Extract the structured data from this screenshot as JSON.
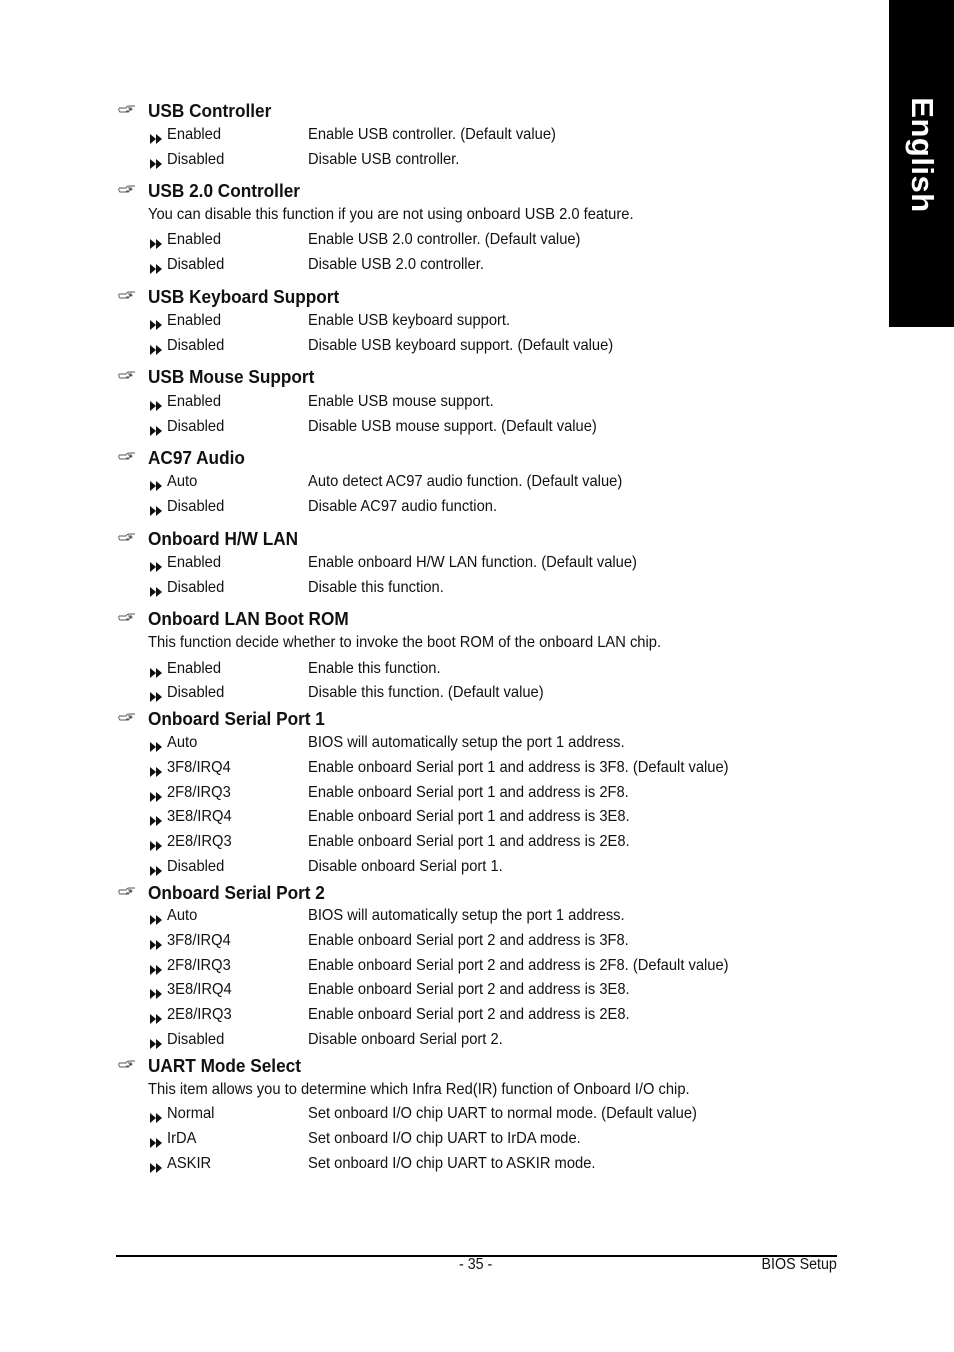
{
  "side_tab": {
    "label": "English"
  },
  "sections": [
    {
      "title": "USB Controller",
      "description": null,
      "options": [
        {
          "value": "Enabled",
          "desc": "Enable USB controller. (Default value)"
        },
        {
          "value": "Disabled",
          "desc": "Disable USB controller."
        }
      ]
    },
    {
      "title": "USB 2.0 Controller",
      "description": "You can disable this function if you are not using onboard USB 2.0 feature.",
      "options": [
        {
          "value": "Enabled",
          "desc": "Enable USB 2.0 controller. (Default value)"
        },
        {
          "value": "Disabled",
          "desc": "Disable USB 2.0 controller."
        }
      ]
    },
    {
      "title": "USB Keyboard Support",
      "description": null,
      "options": [
        {
          "value": "Enabled",
          "desc": "Enable USB keyboard support."
        },
        {
          "value": "Disabled",
          "desc": "Disable USB keyboard support. (Default value)"
        }
      ]
    },
    {
      "title": "USB Mouse Support",
      "description": null,
      "options": [
        {
          "value": "Enabled",
          "desc": "Enable USB mouse support."
        },
        {
          "value": "Disabled",
          "desc": "Disable USB mouse support. (Default value)"
        }
      ]
    },
    {
      "title": "AC97 Audio",
      "description": null,
      "options": [
        {
          "value": "Auto",
          "desc": "Auto detect AC97 audio function. (Default value)"
        },
        {
          "value": "Disabled",
          "desc": "Disable AC97 audio function."
        }
      ]
    },
    {
      "title": "Onboard H/W LAN",
      "description": null,
      "options": [
        {
          "value": "Enabled",
          "desc": "Enable onboard H/W LAN function. (Default value)"
        },
        {
          "value": "Disabled",
          "desc": "Disable this function."
        }
      ]
    },
    {
      "title": "Onboard LAN Boot ROM",
      "description": "This function decide whether to invoke the boot ROM of the onboard LAN chip.",
      "options": [
        {
          "value": "Enabled",
          "desc": "Enable this function."
        },
        {
          "value": "Disabled",
          "desc": "Disable this function. (Default value)"
        }
      ]
    },
    {
      "title": "Onboard Serial Port 1",
      "description": null,
      "options": [
        {
          "value": "Auto",
          "desc": "BIOS will automatically setup the port 1 address."
        },
        {
          "value": "3F8/IRQ4",
          "desc": "Enable onboard Serial port 1 and address is 3F8. (Default value)"
        },
        {
          "value": "2F8/IRQ3",
          "desc": "Enable onboard Serial port 1 and address is 2F8."
        },
        {
          "value": "3E8/IRQ4",
          "desc": "Enable onboard Serial port 1 and address is 3E8."
        },
        {
          "value": "2E8/IRQ3",
          "desc": "Enable onboard Serial port 1 and address is 2E8."
        },
        {
          "value": "Disabled",
          "desc": "Disable onboard Serial port 1."
        }
      ]
    },
    {
      "title": "Onboard Serial Port 2",
      "description": null,
      "options": [
        {
          "value": "Auto",
          "desc": "BIOS will automatically setup the port 1 address."
        },
        {
          "value": "3F8/IRQ4",
          "desc": "Enable onboard Serial port 2 and address is 3F8."
        },
        {
          "value": "2F8/IRQ3",
          "desc": "Enable onboard Serial port 2 and address is 2F8. (Default value)"
        },
        {
          "value": "3E8/IRQ4",
          "desc": "Enable onboard Serial port 2 and address is 3E8."
        },
        {
          "value": "2E8/IRQ3",
          "desc": "Enable onboard Serial port 2 and address is 2E8."
        },
        {
          "value": "Disabled",
          "desc": "Disable onboard Serial port 2."
        }
      ]
    },
    {
      "title": "UART Mode Select",
      "description": "This item allows you to determine which Infra Red(IR) function of Onboard I/O chip.",
      "options": [
        {
          "value": "Normal",
          "desc": "Set onboard I/O chip UART to normal mode. (Default value)"
        },
        {
          "value": "IrDA",
          "desc": "Set onboard I/O chip UART to IrDA mode."
        },
        {
          "value": "ASKIR",
          "desc": "Set onboard I/O chip UART to ASKIR mode."
        }
      ]
    }
  ],
  "footer": {
    "page_number": "- 35 -",
    "chapter_title": "BIOS Setup"
  }
}
